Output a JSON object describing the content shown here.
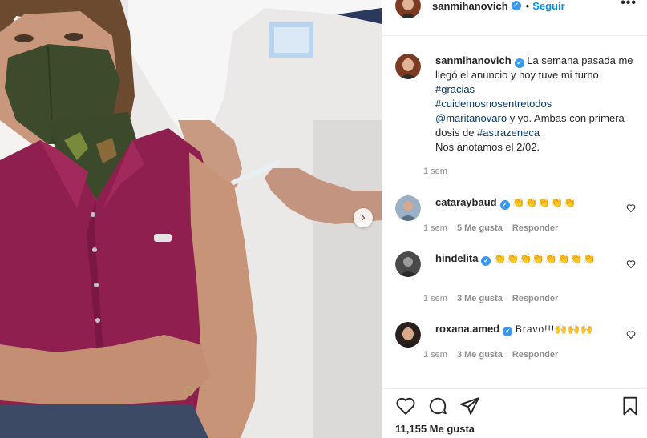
{
  "photo": {
    "alt_desc": "",
    "next_arrow": "›"
  },
  "post": {
    "username": "sanmihanovich",
    "follow_label": "Seguir",
    "dot": "•",
    "more": "•••"
  },
  "caption": {
    "username": "sanmihanovich",
    "text_1": "La semana pasada me llegó el anuncio y hoy tuve mi turno. ",
    "tag_1": "#gracias",
    "tag_2": "#cuidemosnosentretodos",
    "mention": "@maritanovaro",
    "text_2": " y yo. Ambas con primera dosis de ",
    "tag_3": "#astrazeneca",
    "text_3": "Nos anotamos el 2/02.",
    "time": "1 sem"
  },
  "comments": [
    {
      "username": "cataraybaud",
      "text": "👏👏👏👏👏",
      "time": "1 sem",
      "likes": "5 Me gusta",
      "reply": "Responder"
    },
    {
      "username": "hindelita",
      "text": "👏👏👏👏👏👏👏👏",
      "time": "1 sem",
      "likes": "3 Me gusta",
      "reply": "Responder"
    },
    {
      "username": "roxana.amed",
      "text": "Bravo!!!🙌🙌🙌",
      "time": "1 sem",
      "likes": "3 Me gusta",
      "reply": "Responder"
    }
  ],
  "footer": {
    "likes": "11,155 Me gusta"
  },
  "colors": {
    "link": "#00376b",
    "follow": "#0095f6",
    "verified": "#3897f0",
    "muted": "#8e8e8e"
  },
  "icons": [
    "chevron-right-icon",
    "more-icon",
    "verified-icon",
    "heart-icon",
    "comment-icon",
    "share-icon",
    "bookmark-icon"
  ]
}
